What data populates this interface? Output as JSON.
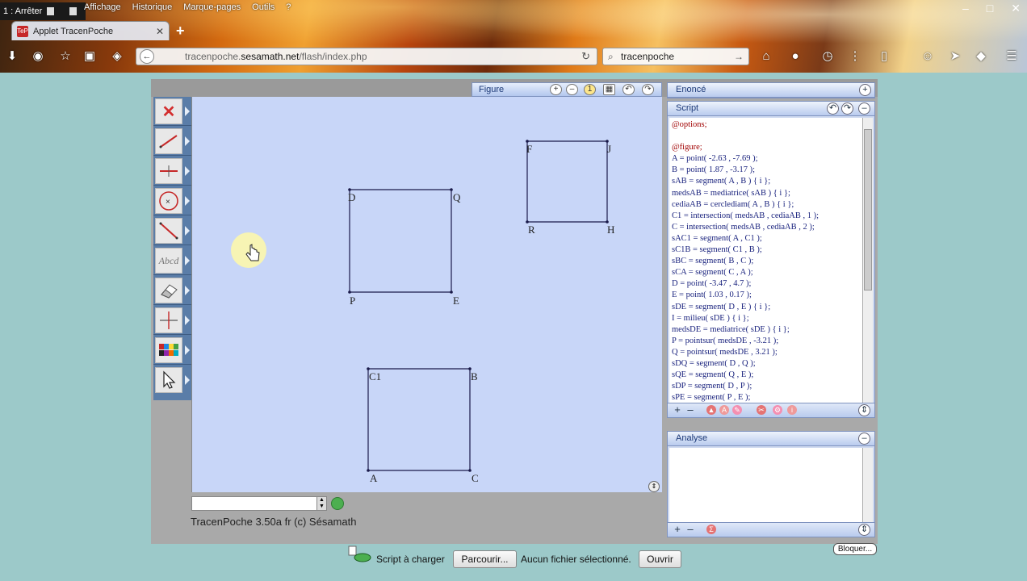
{
  "browser": {
    "stop_label": "1 : Arrêter",
    "menu": [
      "Affichage",
      "Historique",
      "Marque-pages",
      "Outils",
      "?"
    ],
    "tab_title": "Applet TracenPoche",
    "url_prefix": "tracenpoche.",
    "url_host": "sesamath.net",
    "url_path": "/flash/index.php",
    "search_value": "tracenpoche",
    "window_controls": [
      "–",
      "□",
      "✕"
    ]
  },
  "figure": {
    "title": "Figure",
    "zoom_badge": "1",
    "points": [
      {
        "name": "D"
      },
      {
        "name": "Q"
      },
      {
        "name": "P"
      },
      {
        "name": "E"
      },
      {
        "name": "F"
      },
      {
        "name": "J"
      },
      {
        "name": "R"
      },
      {
        "name": "H"
      },
      {
        "name": "C1"
      },
      {
        "name": "B"
      },
      {
        "name": "A"
      },
      {
        "name": "C"
      }
    ]
  },
  "toolbar": {
    "text_tool_label": "Abcd"
  },
  "enonce": {
    "title": "Enoncé"
  },
  "script": {
    "title": "Script",
    "lines": [
      "@options;",
      "",
      "@figure;",
      " A = point( -2.63 , -7.69 );",
      " B = point( 1.87 , -3.17 );",
      " sAB = segment( A , B )  { i };",
      " medsAB = mediatrice( sAB )  { i };",
      " cediaAB = cerclediam( A , B )  { i };",
      " C1 = intersection( medsAB , cediaAB , 1 );",
      " C = intersection( medsAB , cediaAB , 2 );",
      " sAC1 = segment( A , C1 );",
      " sC1B = segment( C1 , B );",
      " sBC = segment( B , C );",
      " sCA = segment( C , A );",
      " D = point( -3.47 , 4.7 );",
      " E = point( 1.03 , 0.17 );",
      " sDE = segment( D , E )  { i };",
      " I = milieu( sDE )  { i };",
      " medsDE = mediatrice( sDE )  { i };",
      " P = pointsur( medsDE , -3.21 );",
      " Q = pointsur( medsDE , 3.21 );",
      " sDQ = segment( D , Q );",
      " sQE = segment( Q , E );",
      " sDP = segment( D , P );",
      " sPE = segment( P , E );"
    ]
  },
  "analyse": {
    "title": "Analyse"
  },
  "footer": {
    "credit": "TracenPoche 3.50a fr (c) Sésamath",
    "script_label": "Script à charger",
    "browse_button": "Parcourir...",
    "no_file": "Aucun fichier sélectionné.",
    "open_button": "Ouvrir",
    "lock_button": "Bloquer..."
  },
  "colors": {
    "canvas_bg": "#c8d6f8",
    "toolbar_bg": "#5a7da8",
    "page_bg": "#9cc9c9",
    "segment": "#1a1a4a"
  }
}
